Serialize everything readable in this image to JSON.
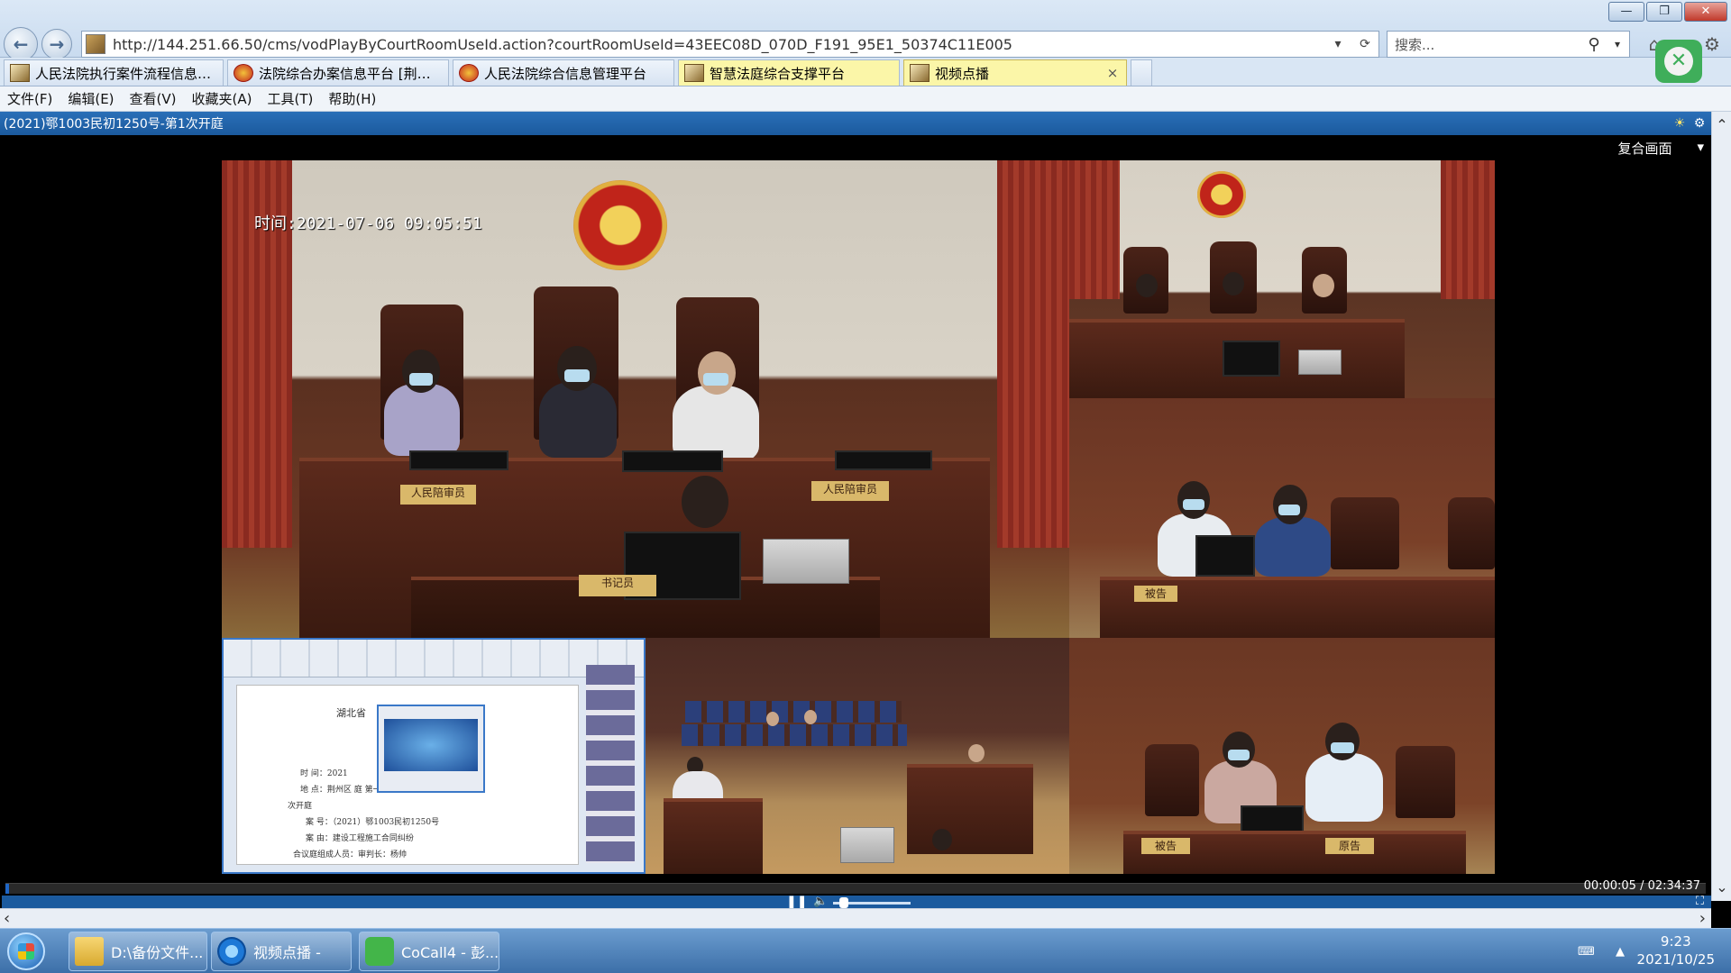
{
  "browser": {
    "url": "http://144.251.66.50/cms/vodPlayByCourtRoomUseId.action?courtRoomUseId=43EEC08D_070D_F191_95E1_50374C11E005",
    "search_placeholder": "搜索...",
    "tabs": [
      {
        "label": "人民法院执行案件流程信息管..."
      },
      {
        "label": "法院综合办案信息平台 [荆州..."
      },
      {
        "label": "人民法院综合信息管理平台"
      },
      {
        "label": "智慧法庭综合支撑平台"
      },
      {
        "label": "视频点播",
        "close": "×"
      }
    ],
    "menu": [
      "文件(F)",
      "编辑(E)",
      "查看(V)",
      "收藏夹(A)",
      "工具(T)",
      "帮助(H)"
    ]
  },
  "page": {
    "title": "(2021)鄂1003民初1250号-第1次开庭"
  },
  "player": {
    "layout_label": "复合画面",
    "timestamp": "时间:2021-07-06 09:05:51",
    "current_time": "00:00:05",
    "total_time": "02:34:37",
    "time_separator": " / ",
    "progress": 0.0005,
    "volume": 0.08
  },
  "scene": {
    "sign_juror_left": "人民陪审员",
    "sign_juror_right": "人民陪审员",
    "sign_clerk": "书记员",
    "sign_defendant": "被告",
    "sign_defendant_2": "被告",
    "sign_plaintiff": "原告"
  },
  "doc_screen": {
    "lines": [
      "湖北省",
      "时    间：2021",
      "地    点：荆州区                                庭    第一",
      "次开庭",
      "案    号：（2021）鄂1003民初1250号",
      "案    由：建设工程施工合同纠纷",
      "合议庭组成人员：审判长：杨帅"
    ]
  },
  "taskbar": {
    "tasks": [
      {
        "label": "D:\\备份文件..."
      },
      {
        "label": "视频点播 -"
      },
      {
        "label": "CoCall4 - 彭..."
      }
    ],
    "clock_time": "9:23",
    "clock_date": "2021/10/25"
  },
  "colors": {
    "title_bar": "#1b5a9e",
    "progress": "#1f66c5",
    "active_tab": "#fbf6a8"
  }
}
